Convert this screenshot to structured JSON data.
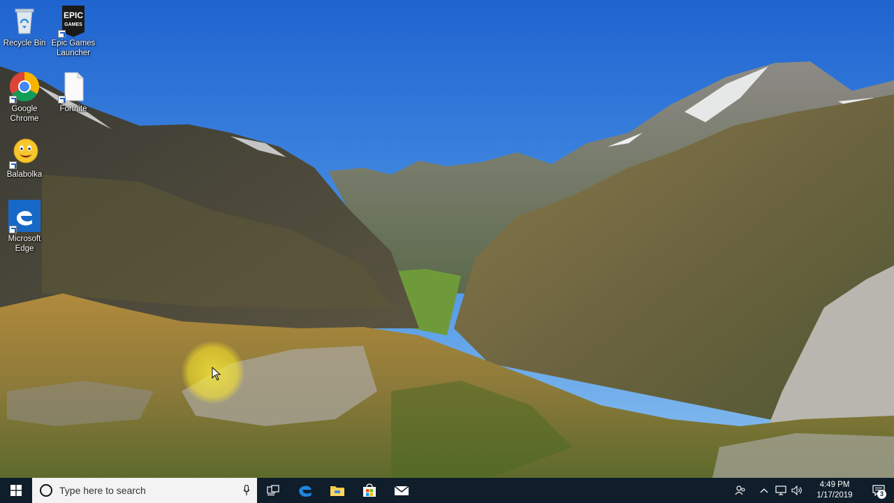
{
  "desktop": {
    "icons": [
      {
        "label": "Recycle Bin",
        "icon": "recycle-bin-icon"
      },
      {
        "label": "Epic Games Launcher",
        "icon": "epic-games-icon",
        "logo_text": "EPIC GAMES"
      },
      {
        "label": "Google Chrome",
        "icon": "chrome-icon"
      },
      {
        "label": "Fortnite",
        "icon": "file-icon"
      },
      {
        "label": "Balabolka",
        "icon": "balabolka-icon"
      },
      {
        "label": "Microsoft Edge",
        "icon": "edge-icon"
      }
    ]
  },
  "taskbar": {
    "start_icon": "windows-logo-icon",
    "search": {
      "placeholder": "Type here to search"
    },
    "pinned": [
      "task-view-icon",
      "edge-icon",
      "file-explorer-icon",
      "store-icon",
      "mail-icon"
    ],
    "tray": [
      "people-icon",
      "chevron-up-icon",
      "network-icon",
      "volume-icon"
    ],
    "clock": {
      "time": "4:49 PM",
      "date": "1/17/2019"
    },
    "notifications": {
      "count": "3"
    }
  },
  "colors": {
    "taskbar": "#101d2b",
    "accent": "#0078d7",
    "halo": "#ffec3c"
  }
}
